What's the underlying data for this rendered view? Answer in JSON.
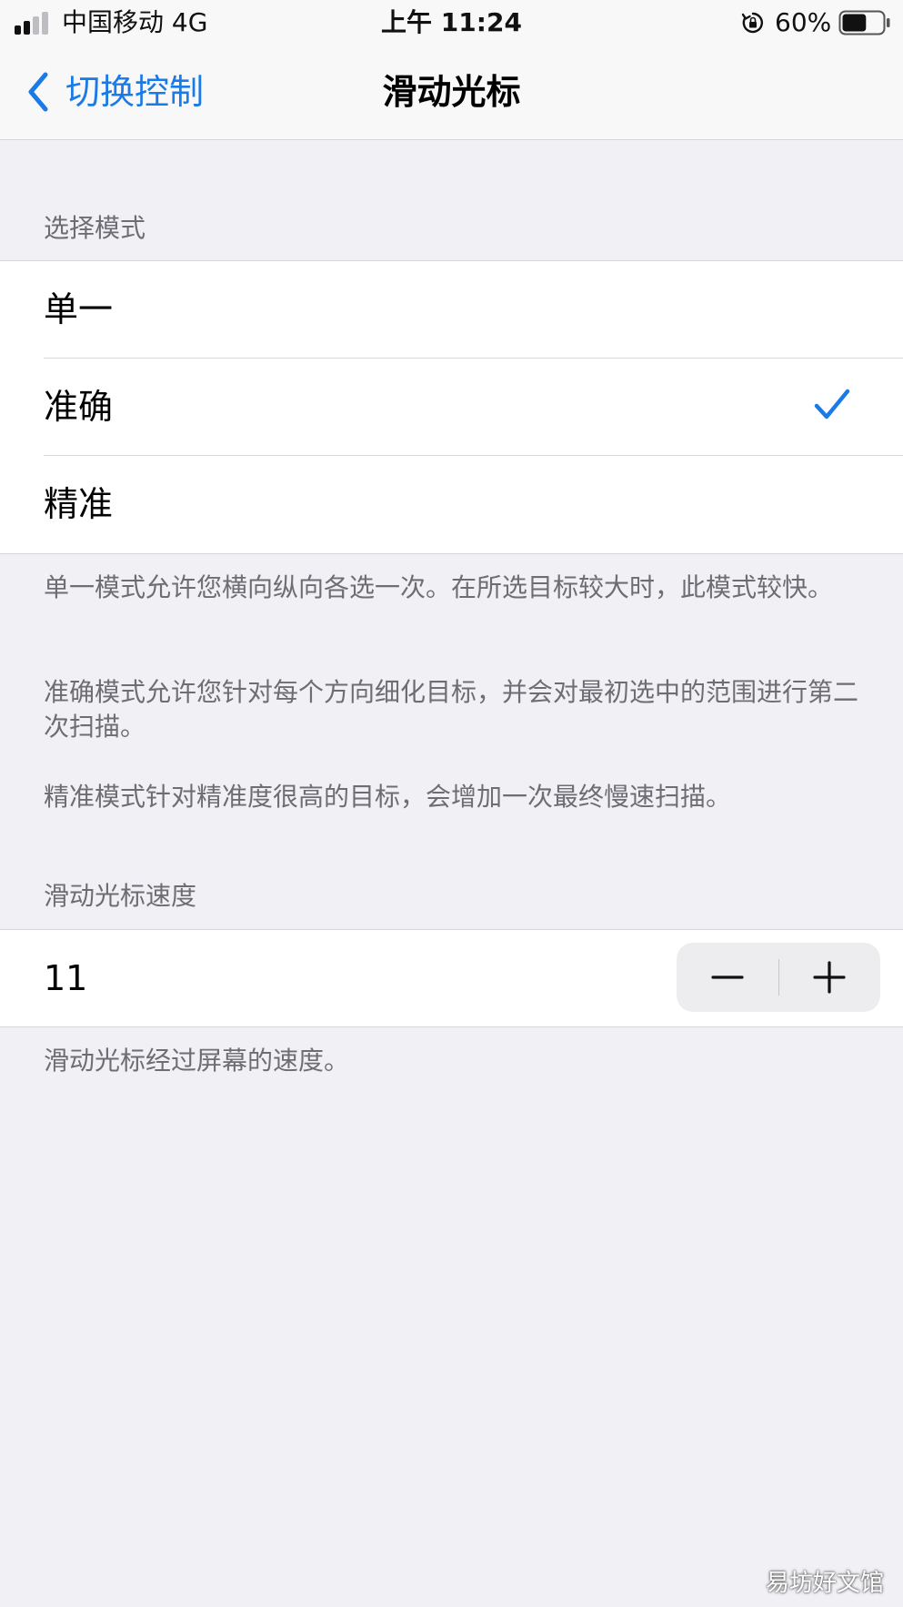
{
  "status_bar": {
    "carrier": "中国移动   4G",
    "time": "上午 11:24",
    "battery_percent": "60%",
    "battery_level": 0.6,
    "signal_bars_active": 2,
    "signal_bars_total": 4,
    "icons": [
      "signal-icon",
      "orientation-lock-icon",
      "battery-icon"
    ]
  },
  "nav": {
    "back_label": "切换控制",
    "title": "滑动光标",
    "accent_color": "#1a7ae6"
  },
  "selection_mode": {
    "header": "选择模式",
    "options": [
      {
        "label": "单一",
        "selected": false
      },
      {
        "label": "准确",
        "selected": true
      },
      {
        "label": "精准",
        "selected": false
      }
    ],
    "footer": [
      "单一模式允许您横向纵向各选一次。在所选目标较大时，此模式较快。",
      "准确模式允许您针对每个方向细化目标，并会对最初选中的范围进行第二次扫描。",
      "精准模式针对精准度很高的目标，会增加一次最终慢速扫描。"
    ]
  },
  "speed": {
    "header": "滑动光标速度",
    "value": "11",
    "footer": "滑动光标经过屏幕的速度。"
  },
  "watermark": "易坊好文馆"
}
